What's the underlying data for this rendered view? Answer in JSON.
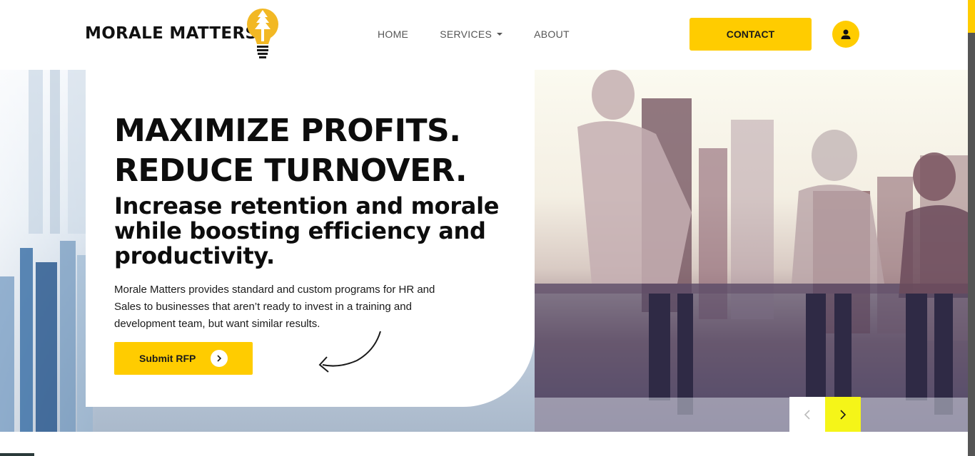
{
  "header": {
    "brand": "MORALE MATTERS",
    "logo_icon": "lightbulb-tree-icon",
    "nav": [
      {
        "label": "HOME"
      },
      {
        "label": "SERVICES",
        "has_dropdown": true
      },
      {
        "label": "ABOUT"
      }
    ],
    "contact_label": "CONTACT",
    "user_icon": "user-icon"
  },
  "hero": {
    "headline_line1": "MAXIMIZE PROFITS.",
    "headline_line2": "REDUCE TURNOVER.",
    "subheadline": "Increase retention and morale while boosting efficiency and productivity.",
    "body": "Morale Matters provides standard and custom programs for HR and Sales to businesses that aren’t ready to invest in a training and development team, but want similar results.",
    "cta_label": "Submit RFP",
    "cta_icon": "chevron-right-icon",
    "arrow_icon": "curved-arrow-icon",
    "image": "business-team-silhouette-photo"
  },
  "slider": {
    "prev_icon": "chevron-left-icon",
    "next_icon": "chevron-right-icon"
  },
  "colors": {
    "accent": "#ffcc00",
    "slider_next": "#f5f518",
    "text_dark": "#0d0d0d",
    "nav_text": "#555555"
  }
}
